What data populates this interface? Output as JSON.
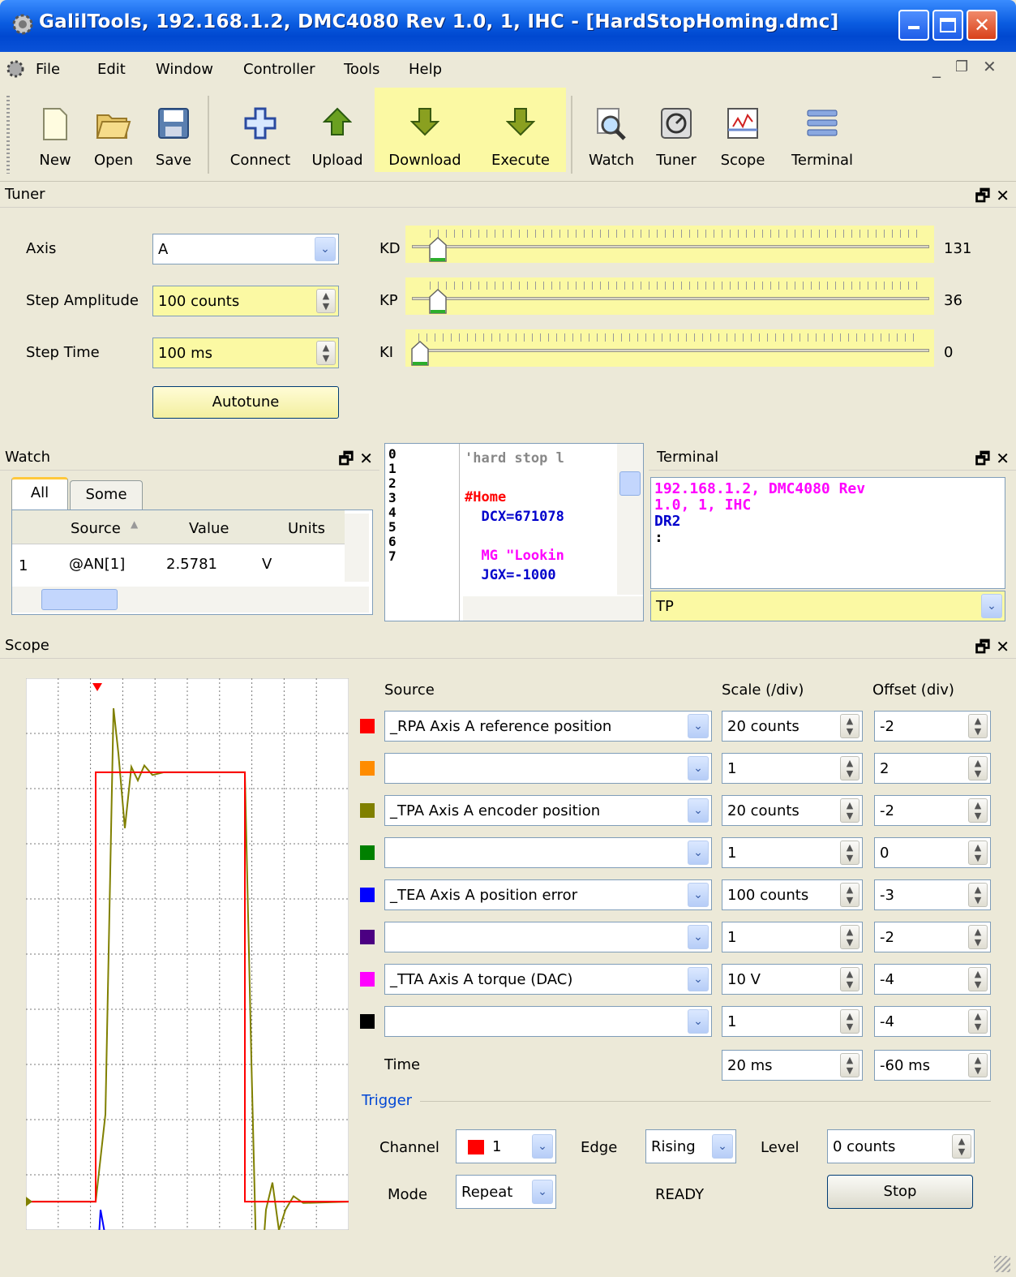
{
  "window": {
    "title": "GalilTools, 192.168.1.2, DMC4080 Rev 1.0, 1, IHC - [HardStopHoming.dmc]"
  },
  "menu": [
    "File",
    "Edit",
    "Window",
    "Controller",
    "Tools",
    "Help"
  ],
  "toolbar": {
    "new": "New",
    "open": "Open",
    "save": "Save",
    "connect": "Connect",
    "upload": "Upload",
    "download": "Download",
    "execute": "Execute",
    "watch": "Watch",
    "tuner": "Tuner",
    "scope": "Scope",
    "terminal": "Terminal"
  },
  "tuner": {
    "title": "Tuner",
    "axis_label": "Axis",
    "axis_value": "A",
    "amp_label": "Step Amplitude",
    "amp_value": "100 counts",
    "time_label": "Step Time",
    "time_value": "100 ms",
    "autotune": "Autotune",
    "kd_label": "KD",
    "kd_value": "131",
    "kp_label": "KP",
    "kp_value": "36",
    "ki_label": "KI",
    "ki_value": "0"
  },
  "watch": {
    "title": "Watch",
    "tabs": [
      "All",
      "Some"
    ],
    "headers": [
      "Source",
      "Value",
      "Units"
    ],
    "rows": [
      {
        "n": "1",
        "source": "@AN[1]",
        "value": "2.5781",
        "units": "V"
      }
    ]
  },
  "editor": {
    "line_numbers": [
      "0",
      "1",
      "2",
      "3",
      "4",
      "5",
      "6",
      "7"
    ],
    "lines": [
      {
        "text": "'hard stop l",
        "color": "#888888"
      },
      {
        "text": "",
        "color": "#000000"
      },
      {
        "text": "#Home",
        "color": "#ff0000"
      },
      {
        "text": "  DCX=671078",
        "color": "#0000cc"
      },
      {
        "text": "",
        "color": "#000000"
      },
      {
        "text": "  MG \"Lookin",
        "color": "#ff00ff"
      },
      {
        "text": "  JGX=-1000",
        "color": "#0000cc"
      }
    ]
  },
  "terminal": {
    "title": "Terminal",
    "output": [
      {
        "text": "192.168.1.2, DMC4080 Rev",
        "color": "#ff00ff"
      },
      {
        "text": "1.0, 1, IHC",
        "color": "#ff00ff"
      },
      {
        "text": "DR2",
        "color": "#0000cc"
      },
      {
        "text": ":",
        "color": "#000000"
      }
    ],
    "input": "TP"
  },
  "scope": {
    "title": "Scope",
    "headers": {
      "source": "Source",
      "scale": "Scale (/div)",
      "offset": "Offset (div)"
    },
    "channels": [
      {
        "color": "#ff0000",
        "source": "_RPA Axis A reference position",
        "scale": "20 counts",
        "offset": "-2"
      },
      {
        "color": "#ff8c00",
        "source": "",
        "scale": "1",
        "offset": "2"
      },
      {
        "color": "#808000",
        "source": "_TPA Axis A encoder position",
        "scale": "20 counts",
        "offset": "-2"
      },
      {
        "color": "#008000",
        "source": "",
        "scale": "1",
        "offset": "0"
      },
      {
        "color": "#0000ff",
        "source": "_TEA Axis A position error",
        "scale": "100 counts",
        "offset": "-3"
      },
      {
        "color": "#4b0082",
        "source": "",
        "scale": "1",
        "offset": "-2"
      },
      {
        "color": "#ff00ff",
        "source": "_TTA Axis A torque (DAC)",
        "scale": "10 V",
        "offset": "-4"
      },
      {
        "color": "#000000",
        "source": "",
        "scale": "1",
        "offset": "-4"
      }
    ],
    "time_label": "Time",
    "time_scale": "20 ms",
    "time_offset": "-60 ms",
    "trigger": {
      "title": "Trigger",
      "channel_label": "Channel",
      "channel_value": "1",
      "edge_label": "Edge",
      "edge_value": "Rising",
      "level_label": "Level",
      "level_value": "0 counts",
      "mode_label": "Mode",
      "mode_value": "Repeat",
      "status": "READY",
      "stop": "Stop"
    }
  }
}
